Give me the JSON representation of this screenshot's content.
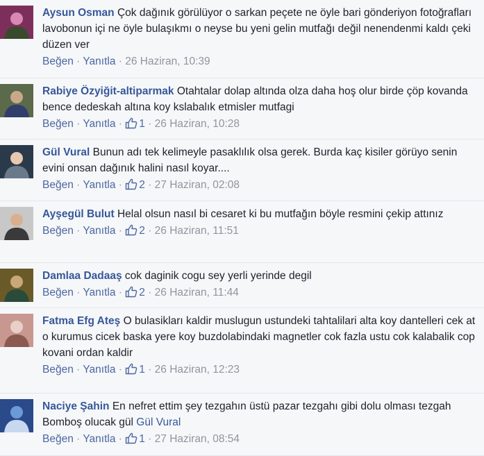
{
  "colors": {
    "link_blue": "#365899",
    "action_blue": "#4b67a1",
    "meta_grey": "#90949c",
    "text": "#1d2129",
    "background": "#f6f7f9"
  },
  "labels": {
    "like": "Beğen",
    "reply": "Yanıtla",
    "separator": "·",
    "like_icon": "thumbs-up-icon"
  },
  "comments": [
    {
      "author": "Aysun Osman",
      "text": "Çok dağınık görülüyor o sarkan peçete ne öyle bari gönderiyon fotoğrafları lavobonun içi ne öyle bulaşıkmı o neyse bu yeni gelin mutfağı değil nenendenmi kaldı çeki düzen ver",
      "mention": "",
      "likes": "",
      "time": "26 Haziran, 10:39",
      "avatar_colors": [
        "#7d2f5c",
        "#d988b6",
        "#3a4a2d"
      ]
    },
    {
      "author": "Rabiye Özyiğit-altiparmak",
      "text": "Otahtalar dolap altında olza daha hoş olur birde çöp kovanda bence dedeskah altına koy kslabalık etmisler mutfagi",
      "mention": "",
      "likes": "1",
      "time": "26 Haziran, 10:28",
      "avatar_colors": [
        "#5a6a4a",
        "#c9a88a",
        "#2f3e6a"
      ]
    },
    {
      "author": "Gül Vural",
      "text": "Bunun adı tek kelimeyle pasaklılık olsa gerek. Burda kaç kisiler görüyo senin evini onsan dağınık halini nasıl koyar....",
      "mention": "",
      "likes": "2",
      "time": "27 Haziran, 02:08",
      "avatar_colors": [
        "#2b3a4a",
        "#e8c8b0",
        "#6a7a8a"
      ]
    },
    {
      "author": "Ayşegül Bulut",
      "text": "Helal olsun nasıl bi cesaret ki bu mutfağın böyle resmini çekip attınız",
      "mention": "",
      "likes": "2",
      "time": "26 Haziran, 11:51",
      "avatar_colors": [
        "#c8c8c8",
        "#d8b090",
        "#3a3a3a"
      ]
    },
    {
      "author": "Damlaa Dadaaş",
      "text": "cok daginik cogu sey yerli yerinde degil",
      "mention": "",
      "likes": "2",
      "time": "26 Haziran, 11:44",
      "avatar_colors": [
        "#6a5a2a",
        "#c8a878",
        "#2a4a3a"
      ]
    },
    {
      "author": "Fatma Efg Ateş",
      "text": "O bulasikları kaldir muslugun ustundeki tahtalilari alta koy dantelleri cek at o kurumus cicek baska yere koy buzdolabindaki magnetler cok fazla ustu cok kalabalik cop kovani ordan kaldir",
      "mention": "",
      "likes": "1",
      "time": "26 Haziran, 12:23",
      "avatar_colors": [
        "#c89890",
        "#e8d0c8",
        "#8a5a50"
      ]
    },
    {
      "author": "Naciye Şahin",
      "text": "En nefret ettim şey tezgahın üstü pazar tezgahı gibi dolu olması tezgah Bomboş olucak gül",
      "mention": "Gül Vural",
      "likes": "1",
      "time": "27 Haziran, 08:54",
      "avatar_colors": [
        "#2a4a8a",
        "#6a9ad8",
        "#c8d8f0"
      ]
    }
  ]
}
